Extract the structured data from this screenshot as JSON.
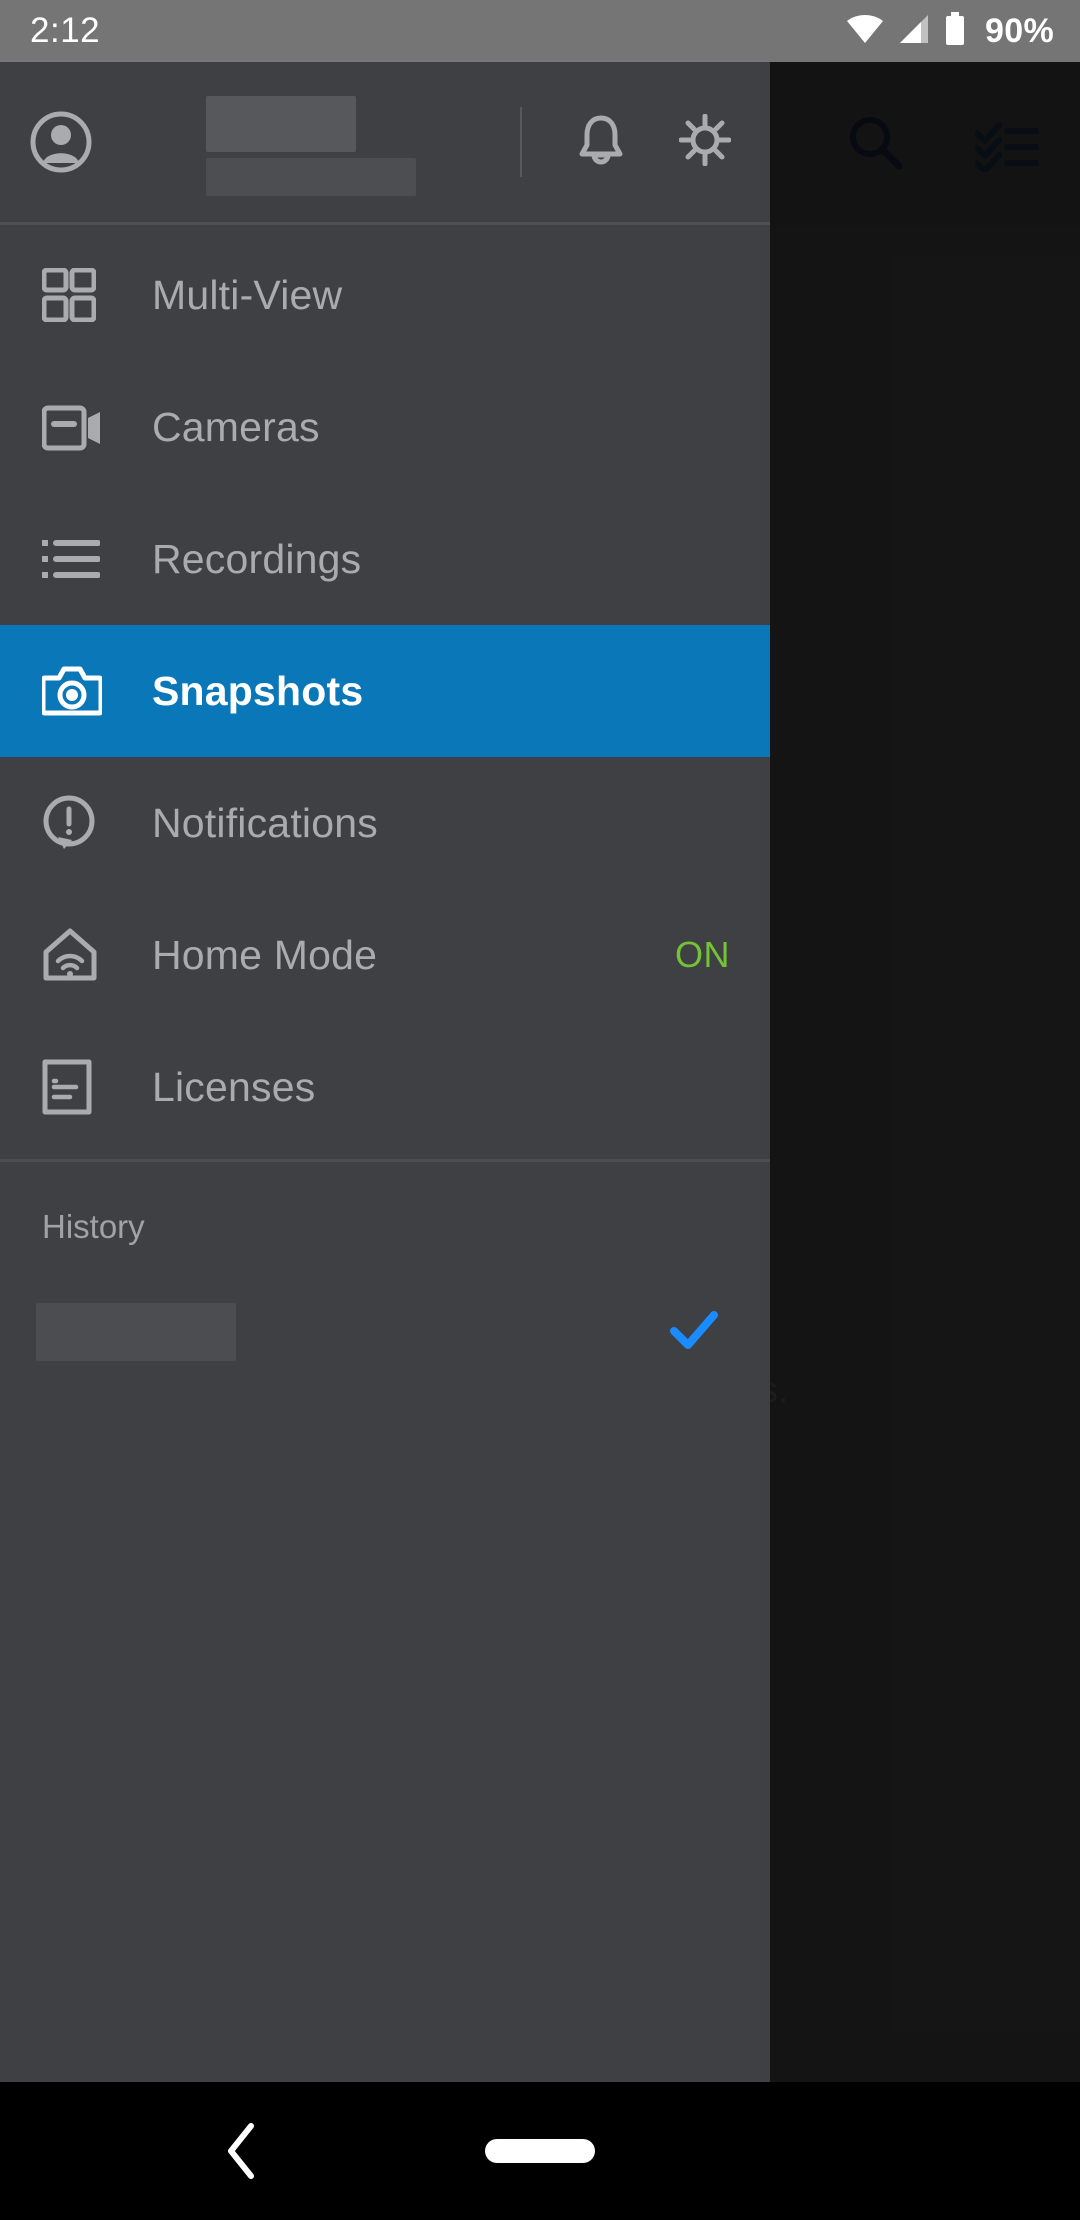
{
  "status_bar": {
    "clock": "2:12",
    "battery_text": "90%",
    "icons": [
      "wifi-icon",
      "cellular-signal-icon",
      "battery-icon"
    ]
  },
  "app_background": {
    "search_icon": "search-icon",
    "checklist_icon": "checklist-select-icon",
    "empty_message": "No snapshots."
  },
  "drawer": {
    "header": {
      "avatar_icon": "account-avatar-icon",
      "account_name": "",
      "account_subtitle": "",
      "notifications_icon": "bell-icon",
      "settings_icon": "gear-icon"
    },
    "menu": [
      {
        "label": "Multi-View",
        "icon": "grid-four-squares-icon",
        "selected": false,
        "trailing": ""
      },
      {
        "label": "Cameras",
        "icon": "video-camera-icon",
        "selected": false,
        "trailing": ""
      },
      {
        "label": "Recordings",
        "icon": "bulleted-list-icon",
        "selected": false,
        "trailing": ""
      },
      {
        "label": "Snapshots",
        "icon": "camera-icon",
        "selected": true,
        "trailing": ""
      },
      {
        "label": "Notifications",
        "icon": "alert-bubble-icon",
        "selected": false,
        "trailing": ""
      },
      {
        "label": "Home Mode",
        "icon": "house-wifi-icon",
        "selected": false,
        "trailing": "ON"
      },
      {
        "label": "Licenses",
        "icon": "document-lines-icon",
        "selected": false,
        "trailing": ""
      }
    ],
    "history": {
      "title": "History",
      "items": [
        {
          "label": "",
          "checked": true,
          "check_icon": "checkmark-icon"
        }
      ]
    }
  },
  "nav_bar": {
    "back_icon": "back-chevron-icon",
    "home_indicator": "home-pill-indicator"
  },
  "colors": {
    "status_bar_bg": "#757575",
    "drawer_bg": "#3e4043",
    "selected_row_bg": "#0a77b8",
    "accent_blue": "#1a8cff",
    "on_green": "#76c236",
    "label_gray": "#a9abad",
    "app_bg": "#262626"
  }
}
